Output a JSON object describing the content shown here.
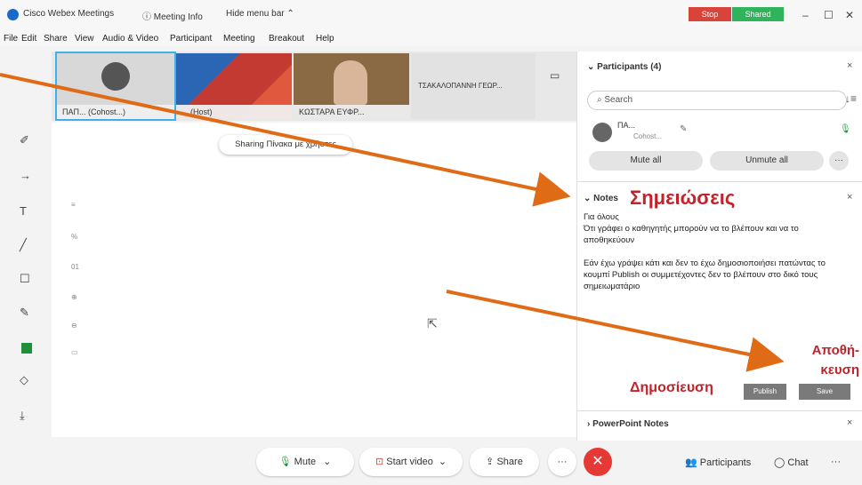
{
  "titlebar": {
    "app_title": "Cisco Webex Meetings",
    "meeting_info": "ⓘ Meeting Info",
    "hide_menu": "Hide menu bar ⌃",
    "stop": "Stop",
    "shared": "Shared"
  },
  "menubar": [
    "File",
    "Edit",
    "Share",
    "View",
    "Audio & Video",
    "Participant",
    "Meeting",
    "Breakout",
    "Help"
  ],
  "videos": [
    {
      "name": "ΠΑΠ... (Cohost...)"
    },
    {
      "name": "... (Host)"
    },
    {
      "name": "ΚΩΣΤΑΡΑ ΕΥΦΡ..."
    },
    {
      "name": "ΤΣΑΚΑΛΟΠΑΝΝΗ ΓΕΩΡ..."
    }
  ],
  "board": {
    "share_tip": "Sharing Πίνακα με χρήστες"
  },
  "participants": {
    "title": "Participants (4)",
    "search_placeholder": "Search",
    "entry_name": "ΠΑ...",
    "entry_role": "Cohost...",
    "mute_all": "Mute all",
    "unmute_all": "Unmute all",
    "more": "···"
  },
  "notes": {
    "title": "Notes",
    "annotation_title": "Σημειώσεις",
    "lines": [
      "Για όλους",
      "Ότι γράφει ο καθηγητής μπορούν να το βλέπουν και να το αποθηκεύουν",
      "",
      "Εάν έχω γράψει κάτι και δεν το έχω δημοσιοποιήσει πατώντας το κουμπί Publish οι συμμετέχοντες δεν το βλέπουν στο δικό τους σημειωματάριο"
    ],
    "annotation_save": "Αποθή-\nκευση",
    "annotation_publish": "Δημοσίευση",
    "publish": "Publish",
    "save": "Save"
  },
  "powerpoint_notes": {
    "title": "PowerPoint Notes"
  },
  "controls": {
    "mute": "Mute",
    "start_video": "Start video",
    "share": "Share",
    "more": "···",
    "participants": "Participants",
    "chat": "Chat",
    "overflow": "···"
  },
  "colors": {
    "arrow": "#e06b17",
    "annotation": "#c2232b",
    "end_call": "#e53935",
    "stop": "#d9443a",
    "shared": "#2fb35b"
  }
}
